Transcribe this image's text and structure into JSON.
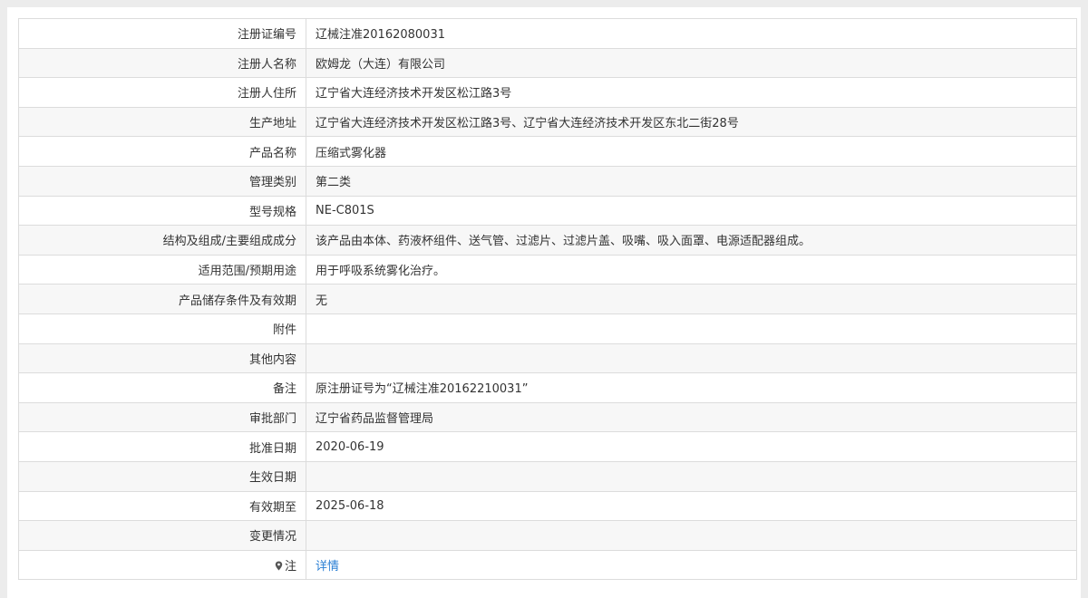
{
  "rows": [
    {
      "label": "注册证编号",
      "value": "辽械注准20162080031"
    },
    {
      "label": "注册人名称",
      "value": "欧姆龙（大连）有限公司"
    },
    {
      "label": "注册人住所",
      "value": "辽宁省大连经济技术开发区松江路3号"
    },
    {
      "label": "生产地址",
      "value": "辽宁省大连经济技术开发区松江路3号、辽宁省大连经济技术开发区东北二街28号"
    },
    {
      "label": "产品名称",
      "value": "压缩式雾化器"
    },
    {
      "label": "管理类别",
      "value": "第二类"
    },
    {
      "label": "型号规格",
      "value": "NE-C801S"
    },
    {
      "label": "结构及组成/主要组成成分",
      "value": "该产品由本体、药液杯组件、送气管、过滤片、过滤片盖、吸嘴、吸入面罩、电源适配器组成。"
    },
    {
      "label": "适用范围/预期用途",
      "value": "用于呼吸系统雾化治疗。"
    },
    {
      "label": "产品储存条件及有效期",
      "value": "无"
    },
    {
      "label": "附件",
      "value": ""
    },
    {
      "label": "其他内容",
      "value": ""
    },
    {
      "label": "备注",
      "value": "原注册证号为“辽械注准20162210031”"
    },
    {
      "label": "审批部门",
      "value": "辽宁省药品监督管理局"
    },
    {
      "label": "批准日期",
      "value": "2020-06-19"
    },
    {
      "label": "生效日期",
      "value": ""
    },
    {
      "label": "有效期至",
      "value": "2025-06-18"
    },
    {
      "label": "变更情况",
      "value": ""
    }
  ],
  "note_row": {
    "icon": "pin-icon",
    "label": "注",
    "link_text": "详情",
    "link_color": "#2a7fd4"
  }
}
